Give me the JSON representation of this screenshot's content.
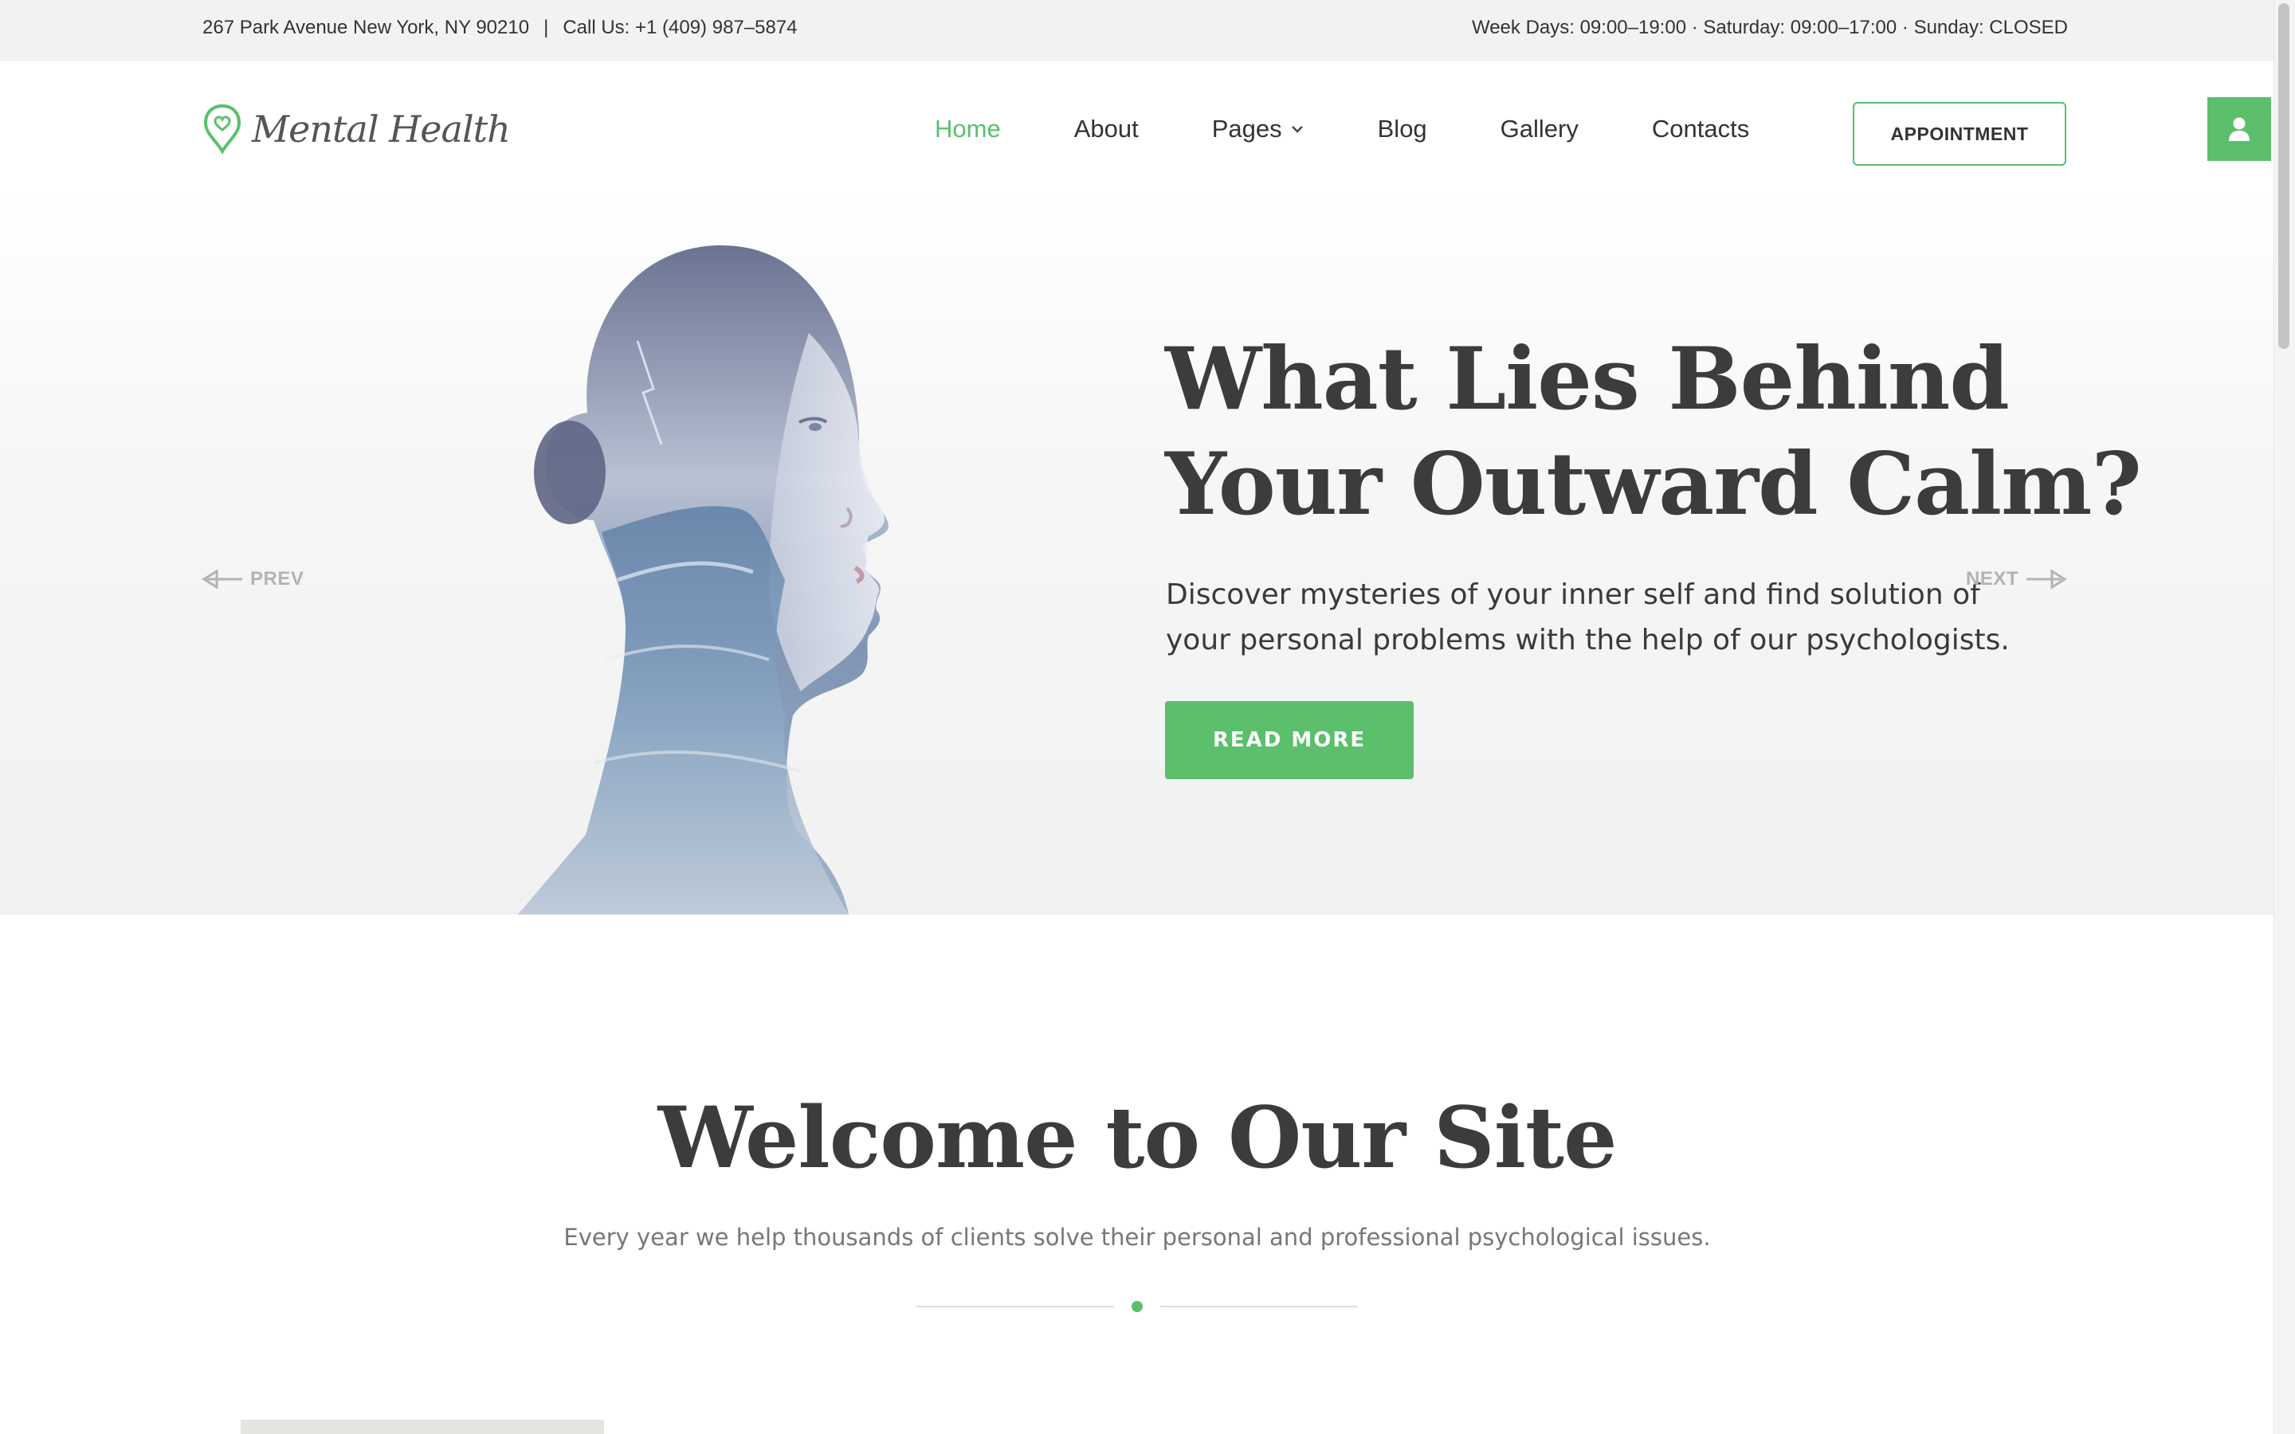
{
  "topbar": {
    "address": "267 Park Avenue New York, NY 90210",
    "separator": "|",
    "phone": "Call Us: +1 (409) 987–5874",
    "hours": "Week Days: 09:00–19:00 · Saturday: 09:00–17:00 · Sunday: CLOSED"
  },
  "logo": {
    "text": "Mental Health"
  },
  "nav": {
    "items": [
      {
        "label": "Home",
        "active": true
      },
      {
        "label": "About"
      },
      {
        "label": "Pages",
        "has_dropdown": true
      },
      {
        "label": "Blog"
      },
      {
        "label": "Gallery"
      },
      {
        "label": "Contacts"
      }
    ],
    "appointment_label": "APPOINTMENT"
  },
  "hero": {
    "title_line1": "What Lies Behind",
    "title_line2": "Your Outward Calm?",
    "lead": "Discover mysteries of your inner self and find solution of your personal problems with the help of our psychologists.",
    "cta_label": "READ MORE",
    "prev_label": "PREV",
    "next_label": "NEXT"
  },
  "welcome": {
    "title": "Welcome to Our Site",
    "subtitle": "Every year we help thousands of clients solve their personal and professional psychological issues."
  },
  "colors": {
    "accent": "#5bbf6c",
    "heading": "#3c3c3c",
    "topbar_bg": "#f2f2f2"
  },
  "icons": {
    "logo": "heart-map-pin-icon",
    "user": "user-icon",
    "dropdown": "chevron-down-icon",
    "prev": "arrow-left-icon",
    "next": "arrow-right-icon"
  }
}
